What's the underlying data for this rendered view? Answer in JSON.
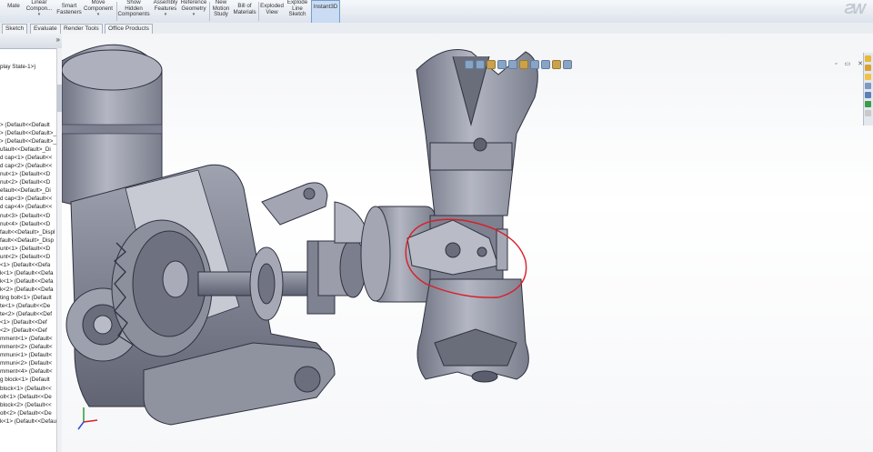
{
  "ribbon": {
    "buttons": [
      {
        "id": "mate",
        "label": "Mate",
        "icon": "mate-icon"
      },
      {
        "id": "linear-component",
        "label": "Linear Compon...",
        "icon": "pattern-icon"
      },
      {
        "id": "smart-fasteners",
        "label": "Smart Fasteners",
        "icon": "fastener-icon"
      },
      {
        "id": "move-component",
        "label": "Move Component",
        "icon": "move-icon"
      },
      {
        "id": "show-hidden",
        "label": "Show Hidden Components",
        "icon": "show-hidden-icon"
      },
      {
        "id": "assembly-features",
        "label": "Assembly Features",
        "icon": "assembly-feature-icon"
      },
      {
        "id": "reference-geometry",
        "label": "Reference Geometry",
        "icon": "reference-geometry-icon"
      },
      {
        "id": "new-motion-study",
        "label": "New Motion Study",
        "icon": "motion-study-icon"
      },
      {
        "id": "bill-of-materials",
        "label": "Bill of Materials",
        "icon": "bom-icon"
      },
      {
        "id": "exploded-view",
        "label": "Exploded View",
        "icon": "exploded-view-icon"
      },
      {
        "id": "explode-line-sketch",
        "label": "Explode Line Sketch",
        "icon": "explode-line-icon"
      },
      {
        "id": "instant3d",
        "label": "Instant3D",
        "icon": "instant3d-icon"
      }
    ]
  },
  "tabs": [
    "Sketch",
    "Evaluate",
    "Render Tools",
    "Office Products"
  ],
  "feature_manager": {
    "expand_glyph": "»",
    "header_item": "play State-1>)",
    "items": [
      "> (Default<<Default",
      "> (Default<<Default>_",
      "> (Default<<Default>_",
      "ufault<<Default>_Di",
      "d cap<1> (Default<<",
      "d cap<2> (Default<<",
      "nut<1> (Default<<D",
      "nut<2> (Default<<D",
      "efault<<Default>_Di",
      "d cap<3> (Default<<",
      "d cap<4> (Default<<",
      "nut<3> (Default<<D",
      "nut<4> (Default<<D",
      "fault<<Default>_Displ",
      "fault<<Default>_Disp",
      "unt<1> (Default<<D",
      "unt<2> (Default<<D",
      "<1> (Default<<Defa",
      "k<1> (Default<<Defa",
      "k<1> (Default<<Defa",
      "k<2> (Default<<Defa",
      "ting bolt<1> (Default",
      "te<1> (Default<<De",
      "te<2> (Default<<Def",
      "<1> (Default<<Def",
      "<2> (Default<<Def",
      "mment<1> (Default<",
      "mment<2> (Default<",
      "mmuni<1> (Default<",
      "mmuni<2> (Default<",
      "mment<4> (Default<",
      "g block<1> (Default",
      "block<1> (Default<<",
      "olt<1> (Default<<De",
      "block<2> (Default<<",
      "olt<2> (Default<<De",
      "k<1> (Default<<Defau"
    ]
  },
  "graphics": {
    "heads_up_icons": [
      "zoom-to-fit-icon",
      "zoom-area-icon",
      "previous-view-icon",
      "section-view-icon",
      "view-orientation-icon",
      "display-style-icon",
      "hide-show-icon",
      "edit-appearance-icon",
      "apply-scene-icon",
      "view-settings-icon"
    ],
    "window_controls": "▫ ▭ ✕",
    "annotation_color": "#d81f2a",
    "part_color": "#8c8f9c"
  },
  "colors": {
    "ribbon_top": "#f6f8fb",
    "highlight": "#c9dcf3"
  }
}
